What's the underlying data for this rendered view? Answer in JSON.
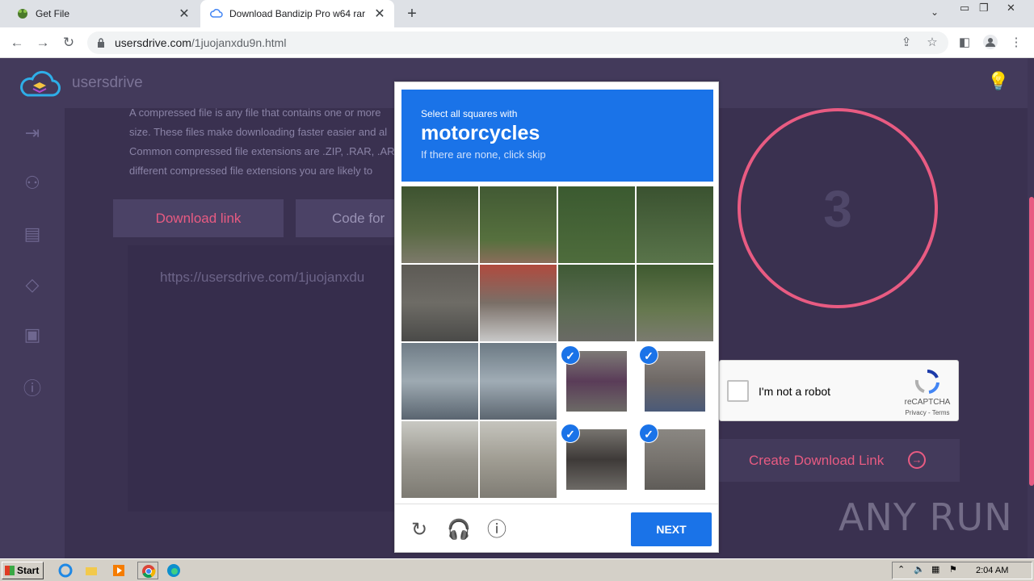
{
  "browser": {
    "tabs": [
      {
        "title": "Get File",
        "icon": "frog-icon"
      },
      {
        "title": "Download Bandizip Pro w64 rar",
        "icon": "cloud-icon"
      }
    ],
    "url_host": "usersdrive.com",
    "url_path": "/1juojanxdu9n.html"
  },
  "site": {
    "brand": "usersdrive",
    "paragraph": "A compressed file is any file that contains one or more size. These files make downloading faster easier and al Common compressed file extensions are .ZIP, .RAR, .AR different compressed file extensions you are likely to",
    "download_link_btn": "Download link",
    "code_btn": "Code for",
    "link_text": "https://usersdrive.com/1juojanxdu",
    "countdown": "3",
    "create_btn": "Create Download Link"
  },
  "recaptcha": {
    "checkbox_label": "I'm not a robot",
    "brand": "reCAPTCHA",
    "privacy": "Privacy - Terms"
  },
  "challenge": {
    "line1": "Select all squares with",
    "target": "motorcycles",
    "line3": "If there are none, click skip",
    "next": "NEXT"
  },
  "watermark": "ANY RUN",
  "taskbar": {
    "start": "Start",
    "clock": "2:04 AM"
  }
}
